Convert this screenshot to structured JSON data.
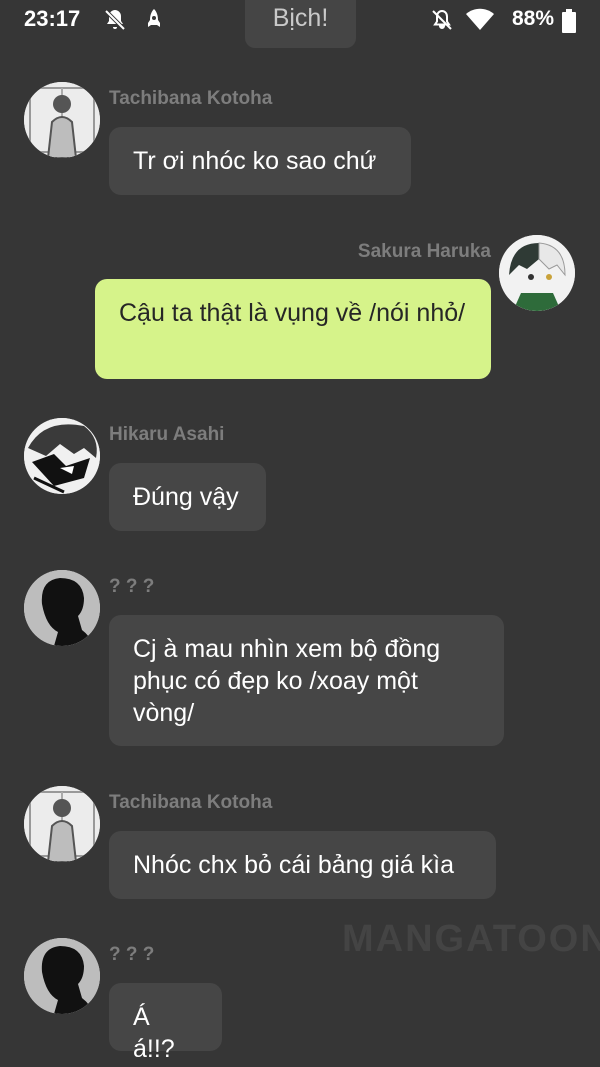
{
  "status_bar": {
    "time": "23:17",
    "battery": "88%"
  },
  "sound_effect": "Bịch!",
  "messages": [
    {
      "sender": "Tachibana Kotoha",
      "text": "Tr ơi nhóc ko sao chứ"
    },
    {
      "sender": "Sakura Haruka",
      "text": "Cậu ta thật là vụng về /nói nhỏ/"
    },
    {
      "sender": "Hikaru Asahi",
      "text": "Đúng vậy"
    },
    {
      "sender": "? ? ?",
      "text": "Cj à mau nhìn xem bộ đồng phục có đẹp ko /xoay một vòng/"
    },
    {
      "sender": "Tachibana Kotoha",
      "text": "Nhóc chx bỏ cái bảng giá kìa"
    },
    {
      "sender": "? ? ?",
      "text": "Á á!!?"
    }
  ],
  "watermark": "MANGATOON"
}
